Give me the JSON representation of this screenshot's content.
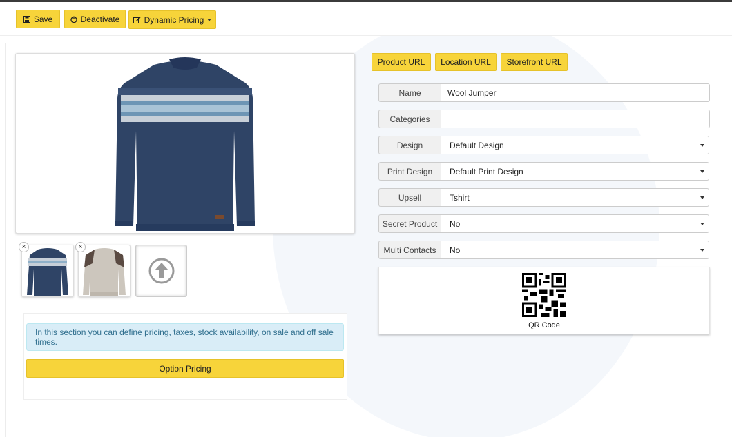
{
  "toolbar": {
    "save_label": "Save",
    "deactivate_label": "Deactivate",
    "dynamic_pricing_label": "Dynamic Pricing"
  },
  "url_buttons": {
    "product_url": "Product URL",
    "location_url": "Location URL",
    "storefront_url": "Storefront URL"
  },
  "form": {
    "name": {
      "label": "Name",
      "value": "Wool Jumper"
    },
    "categories": {
      "label": "Categories",
      "value": ""
    },
    "design": {
      "label": "Design",
      "value": "Default Design"
    },
    "print_design": {
      "label": "Print Design",
      "value": "Default Print Design"
    },
    "upsell": {
      "label": "Upsell",
      "value": "Tshirt"
    },
    "secret_product": {
      "label": "Secret Product",
      "value": "No"
    },
    "multi_contacts": {
      "label": "Multi Contacts",
      "value": "No"
    }
  },
  "qr": {
    "label": "QR Code"
  },
  "thumbs": {
    "remove_symbol": "×"
  },
  "pricing": {
    "info_text": "In this section you can define pricing, taxes, stock availability, on sale and off sale times.",
    "option_pricing_label": "Option Pricing"
  },
  "colors": {
    "accent_yellow": "#f7d43a",
    "sweater_navy": "#2f4466",
    "info_bg": "#d9edf7",
    "info_text": "#31708f"
  },
  "icons": {
    "save": "floppy-disk-icon",
    "deactivate": "power-icon",
    "dynamic_pricing": "edit-icon",
    "upload": "arrow-up-circle-icon",
    "remove": "close-icon"
  }
}
